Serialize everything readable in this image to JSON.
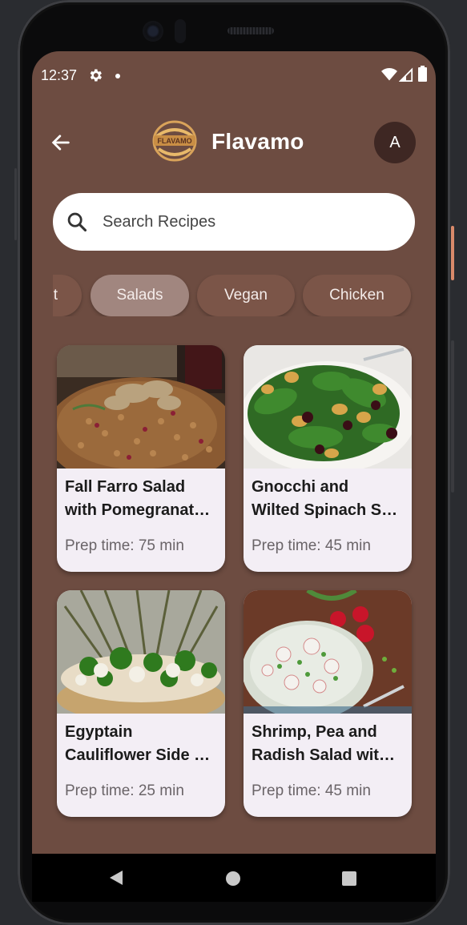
{
  "status_bar": {
    "time": "12:37",
    "icons": [
      "gear-icon",
      "notification-dot",
      "wifi-icon",
      "signal-icon",
      "battery-icon"
    ]
  },
  "header": {
    "back_icon": "arrow-left-icon",
    "logo_text": "FLAVAMO",
    "title": "Flavamo",
    "avatar_initial": "A"
  },
  "search": {
    "placeholder": "Search Recipes",
    "icon": "search-icon"
  },
  "categories": {
    "items": [
      {
        "label": "t"
      },
      {
        "label": "Salads",
        "selected": true
      },
      {
        "label": "Vegan"
      },
      {
        "label": "Chicken"
      }
    ]
  },
  "recipes": [
    {
      "title_line1": "Fall Farro Salad",
      "title_line2": "with Pomegranate Seeds",
      "prep": "Prep time: 75 min"
    },
    {
      "title_line1": "Gnocchi and",
      "title_line2": "Wilted Spinach Salad",
      "prep": "Prep time: 45 min"
    },
    {
      "title_line1": "Egyptain",
      "title_line2": "Cauliflower Side Salad",
      "prep": "Prep time: 25 min"
    },
    {
      "title_line1": "Shrimp, Pea and",
      "title_line2": "Radish Salad with Dill",
      "prep": "Prep time: 45 min"
    }
  ],
  "colors": {
    "background": "#6d4c41",
    "chip": "#7b5548",
    "chip_selected": "#a1867f",
    "card": "#f3eef5",
    "avatar": "#3e2723"
  },
  "nav_bar": {
    "icons": [
      "nav-back-icon",
      "nav-home-icon",
      "nav-recents-icon"
    ]
  }
}
